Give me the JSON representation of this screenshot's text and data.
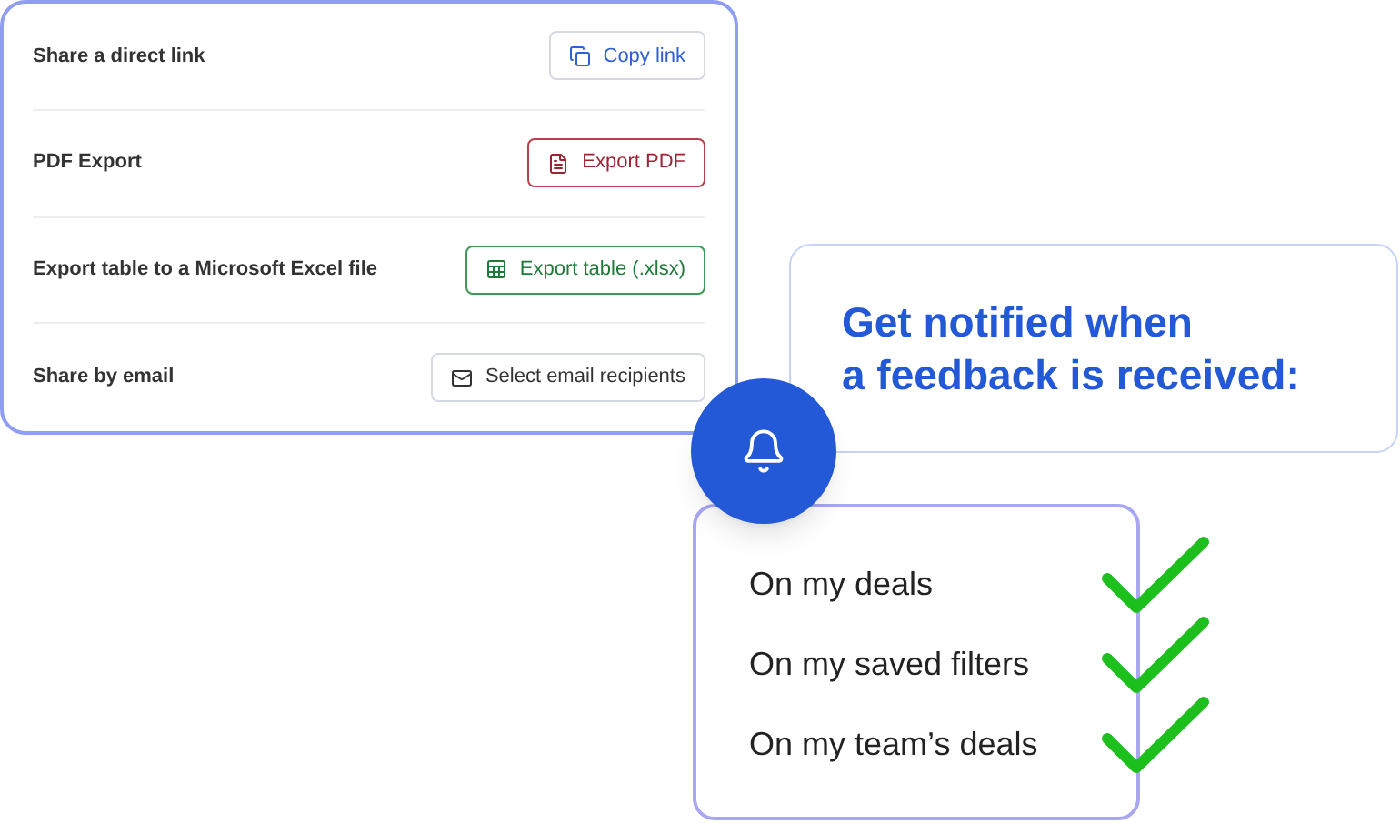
{
  "share_card": {
    "rows": [
      {
        "label": "Share a direct link",
        "button": {
          "kind": "link",
          "label": "Copy link"
        }
      },
      {
        "label": "PDF Export",
        "button": {
          "kind": "pdf",
          "label": "Export PDF"
        }
      },
      {
        "label": "Export table to a Microsoft Excel file",
        "button": {
          "kind": "excel",
          "label": "Export table (.xlsx)"
        }
      },
      {
        "label": "Share by email",
        "button": {
          "kind": "email",
          "label": "Select email recipients"
        }
      }
    ]
  },
  "notify_card": {
    "heading_lines": [
      "Get notified when",
      "a feedback is received:"
    ]
  },
  "options_card": {
    "items": [
      {
        "label": "On my deals",
        "checked": true
      },
      {
        "label": "On my saved filters",
        "checked": true
      },
      {
        "label": "On my team’s deals",
        "checked": true
      }
    ]
  }
}
